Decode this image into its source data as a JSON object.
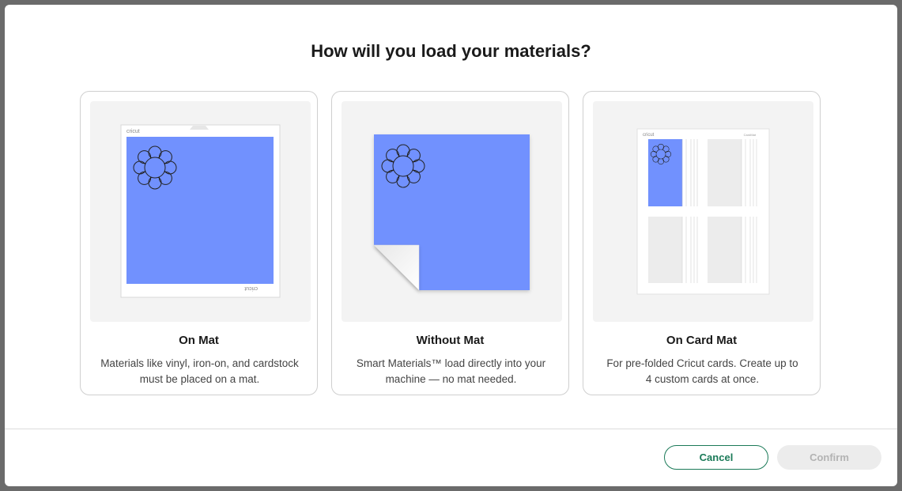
{
  "dialog": {
    "title": "How will you load your materials?"
  },
  "options": [
    {
      "id": "on-mat",
      "title": "On Mat",
      "description": "Materials like vinyl, iron-on, and cardstock must be placed on a mat.",
      "mat_brand": "cricut"
    },
    {
      "id": "without-mat",
      "title": "Without Mat",
      "description": "Smart Materials™ load directly into your machine — no mat needed."
    },
    {
      "id": "on-card-mat",
      "title": "On Card Mat",
      "description": "For pre-folded Cricut cards. Create up to 4 custom cards at once.",
      "mat_brand": "cricut",
      "mat_label": "CardMat"
    }
  ],
  "footer": {
    "cancel_label": "Cancel",
    "confirm_label": "Confirm"
  },
  "colors": {
    "material_blue": "#7191fe",
    "accent_green": "#1b7a58",
    "disabled_text": "#b3b3b3"
  }
}
